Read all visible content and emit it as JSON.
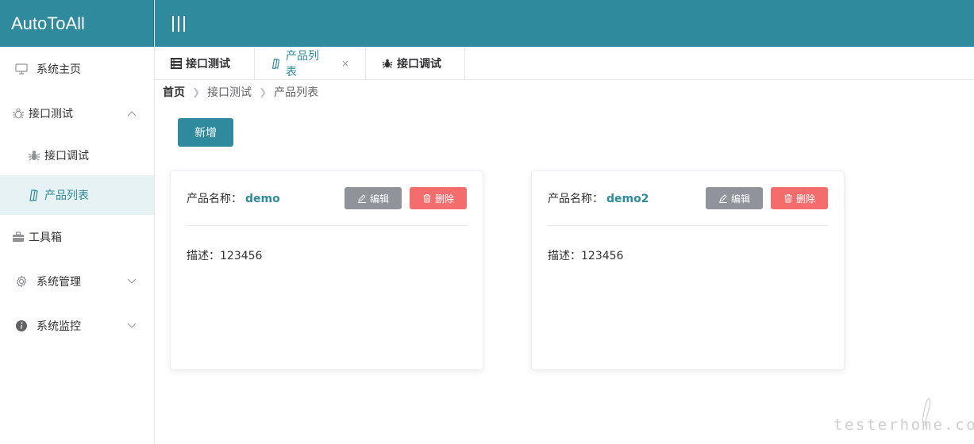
{
  "app": {
    "logo": "AutoToAll"
  },
  "colors": {
    "primary": "#2e8a9c",
    "edit": "#909399",
    "danger": "#f56c6c"
  },
  "sidebar": {
    "items": [
      {
        "label": "系统主页",
        "icon": "monitor-icon"
      },
      {
        "label": "接口测试",
        "icon": "bug-icon",
        "expanded": true
      },
      {
        "label": "接口调试",
        "icon": "bug-icon"
      },
      {
        "label": "产品列表",
        "icon": "product-icon",
        "active": true
      },
      {
        "label": "工具箱",
        "icon": "toolbox-icon"
      },
      {
        "label": "系统管理",
        "icon": "gear-icon"
      },
      {
        "label": "系统监控",
        "icon": "info-icon"
      }
    ]
  },
  "tabs": [
    {
      "label": "接口测试",
      "icon": "list-icon"
    },
    {
      "label": "产品列表",
      "icon": "product-icon",
      "active": true,
      "close": "×"
    },
    {
      "label": "接口调试",
      "icon": "bug-icon"
    }
  ],
  "breadcrumb": {
    "home": "首页",
    "items": [
      "接口测试",
      "产品列表"
    ]
  },
  "toolbar": {
    "add_label": "新增"
  },
  "products": [
    {
      "name_label": "产品名称：",
      "name": "demo",
      "edit_label": "编辑",
      "delete_label": "删除",
      "desc": "描述：123456"
    },
    {
      "name_label": "产品名称：",
      "name": "demo2",
      "edit_label": "编辑",
      "delete_label": "删除",
      "desc": "描述：123456"
    }
  ],
  "watermark": "testerhome.com"
}
